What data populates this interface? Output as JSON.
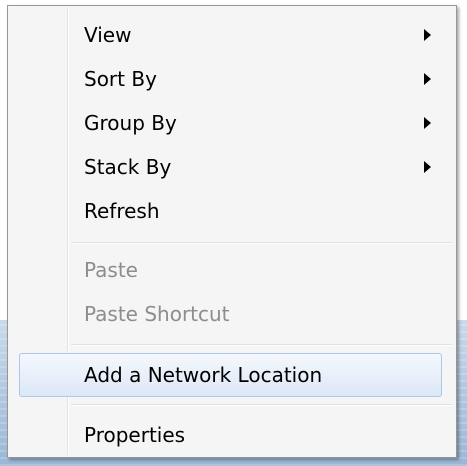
{
  "context_menu": {
    "items": [
      {
        "label": "View",
        "submenu": true,
        "enabled": true
      },
      {
        "label": "Sort By",
        "submenu": true,
        "enabled": true
      },
      {
        "label": "Group By",
        "submenu": true,
        "enabled": true
      },
      {
        "label": "Stack By",
        "submenu": true,
        "enabled": true
      },
      {
        "label": "Refresh",
        "submenu": false,
        "enabled": true
      },
      {
        "label": "Paste",
        "submenu": false,
        "enabled": false
      },
      {
        "label": "Paste Shortcut",
        "submenu": false,
        "enabled": false
      },
      {
        "label": "Add a Network Location",
        "submenu": false,
        "enabled": true,
        "highlighted": true
      },
      {
        "label": "Properties",
        "submenu": false,
        "enabled": true
      }
    ]
  },
  "colors": {
    "menu_background": "#f5f5f5",
    "disabled_text": "#8d8d8d",
    "highlight_border": "#a8c8ec"
  }
}
